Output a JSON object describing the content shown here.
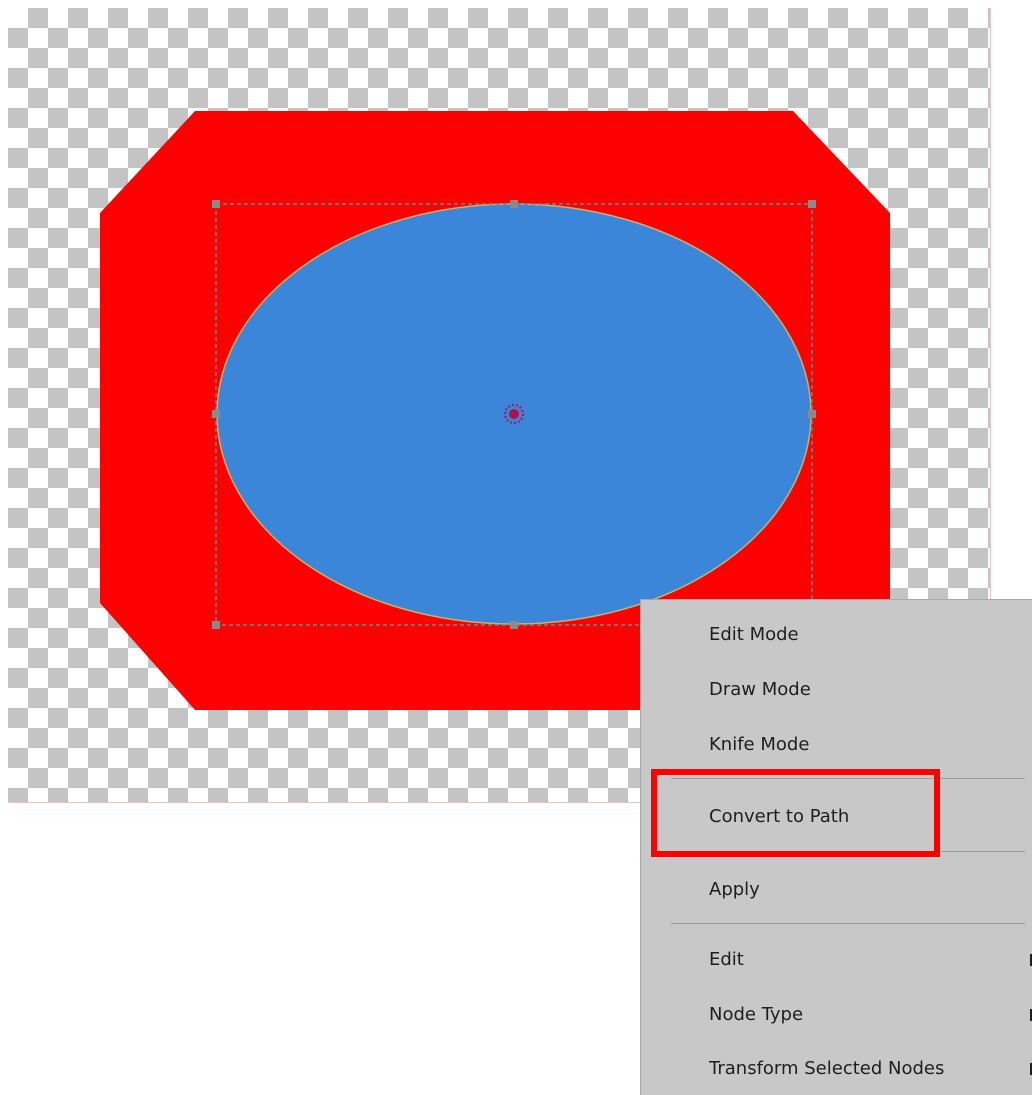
{
  "colors": {
    "octagon_fill": "#ff0000",
    "ellipse_fill": "#3b86d9",
    "selection_dash": "#5f8f8f",
    "handle": "#8a8a8a",
    "center_marker": "#b0104f",
    "menu_background": "#c8c8c8",
    "highlight_border": "#ff0000"
  },
  "canvas": {
    "background": "transparency-checkerboard"
  },
  "selection": {
    "handles": [
      "top-left",
      "top-middle",
      "top-right",
      "middle-left",
      "middle-right",
      "bottom-left",
      "bottom-middle",
      "bottom-right"
    ],
    "center_icon": "center-point-icon"
  },
  "context_menu": {
    "items": [
      {
        "label": "Edit Mode"
      },
      {
        "label": "Draw Mode"
      },
      {
        "label": "Knife Mode"
      },
      {
        "label": "Convert to Path",
        "highlighted": true
      },
      {
        "label": "Apply"
      },
      {
        "label": "Edit",
        "submenu": true
      },
      {
        "label": "Node Type",
        "submenu": true
      },
      {
        "label": "Transform Selected Nodes",
        "submenu": true
      }
    ]
  }
}
